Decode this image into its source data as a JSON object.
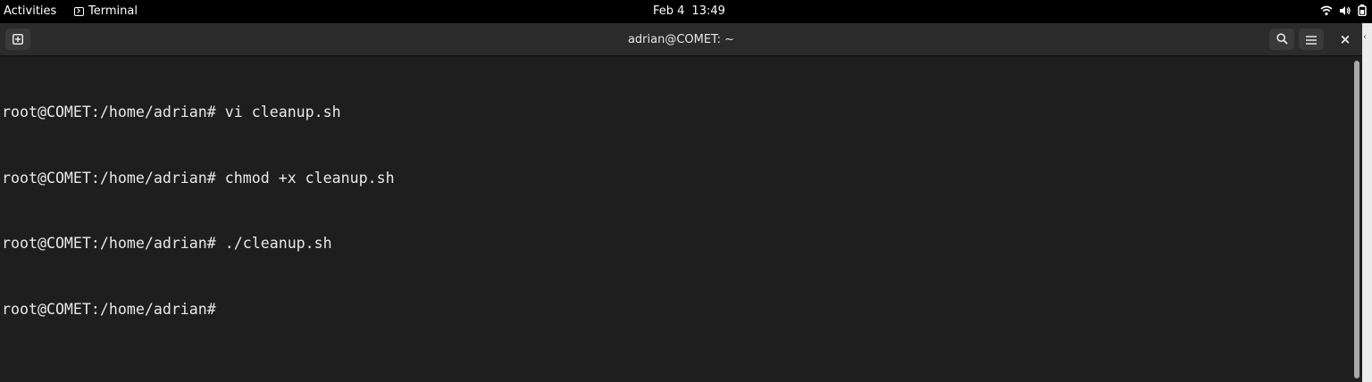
{
  "topbar": {
    "activities": "Activities",
    "app_name": "Terminal",
    "date": "Feb 4",
    "time": "13:49",
    "icons": [
      "wifi-icon",
      "volume-icon",
      "battery-icon"
    ]
  },
  "window": {
    "title": "adrian@COMET: ~",
    "buttons": {
      "new_tab_icon": "new-tab-icon",
      "search_icon": "search-icon",
      "menu_icon": "hamburger-menu-icon",
      "close_label": "×"
    }
  },
  "terminal": {
    "lines": [
      "root@COMET:/home/adrian# vi cleanup.sh",
      "root@COMET:/home/adrian# chmod +x cleanup.sh",
      "root@COMET:/home/adrian# ./cleanup.sh",
      "root@COMET:/home/adrian# "
    ]
  },
  "colors": {
    "terminal_bg": "#1e1e1e",
    "headerbar_bg": "#2b2b2b",
    "text": "#e8e8e8",
    "topbar_bg": "#000000"
  },
  "edge": {
    "chevron": "‹"
  }
}
